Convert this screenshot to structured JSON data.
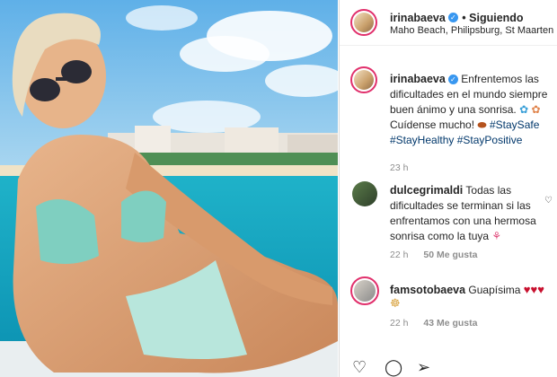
{
  "header": {
    "username": "irinabaeva",
    "follow_state": "• Siguiendo",
    "location": "Maho Beach, Philipsburg, St Maarten"
  },
  "caption": {
    "username": "irinabaeva",
    "line1": "Enfrentemos las",
    "line2": "dificultades en el mundo siempre",
    "line3": "buen ánimo y una sonrisa.",
    "line4_text": "Cuídense mucho!",
    "tags_line4": "#StaySafe",
    "tags_line5": "#StayHealthy #StayPositive",
    "time": "23 h"
  },
  "comments": [
    {
      "username": "dulcegrimaldi",
      "text_rest": " Todas las dificultades se terminan si las enfrentamos con una hermosa sonrisa como la tuya",
      "time": "22 h",
      "likes": "50 Me gusta"
    },
    {
      "username": "famsotobaeva",
      "text_rest": " Guapísima",
      "time": "22 h",
      "likes": "43 Me gusta"
    }
  ],
  "icons": {
    "verified": "verified-badge-icon",
    "like": "heart-icon",
    "comment": "comment-icon",
    "share": "paper-plane-icon"
  },
  "colors": {
    "verified": "#3897f0",
    "hashtag": "#00376b",
    "muted": "#8e8e8e",
    "story_ring": "#e1306c"
  }
}
